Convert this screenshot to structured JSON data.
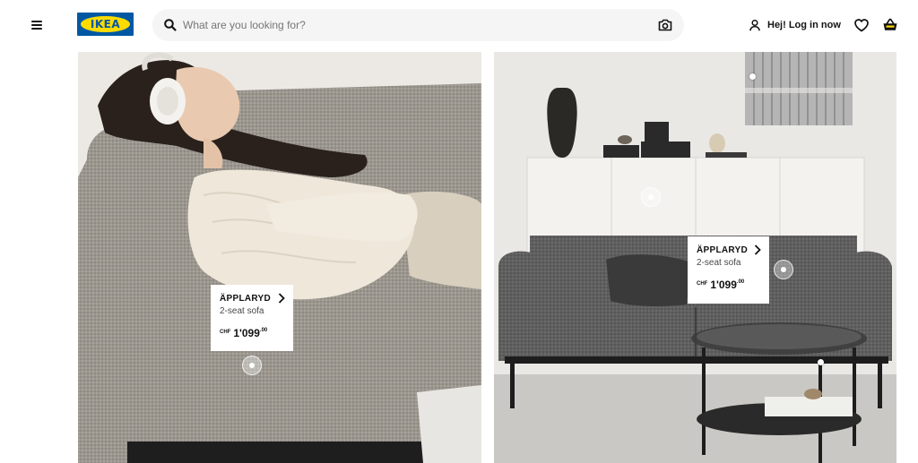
{
  "header": {
    "logo_text": "IKEA",
    "search_placeholder": "What are you looking for?",
    "login_label": "Hej! Log in now"
  },
  "icons": [
    "hamburger-menu-icon",
    "search-icon",
    "camera-icon",
    "user-icon",
    "heart-icon",
    "shopping-basket-icon",
    "chevron-right-icon"
  ],
  "colors": {
    "brand_blue": "#0058a3",
    "brand_yellow": "#ffdb00",
    "search_bg": "#f5f5f5"
  },
  "hero_left": {
    "product": {
      "name": "ÄPPLARYD",
      "description": "2-seat sofa",
      "currency": "CHF",
      "price_int": "1'099",
      "price_dec": ".00"
    }
  },
  "hero_right": {
    "product": {
      "name": "ÄPPLARYD",
      "description": "2-seat sofa",
      "currency": "CHF",
      "price_int": "1'099",
      "price_dec": ".00"
    }
  }
}
